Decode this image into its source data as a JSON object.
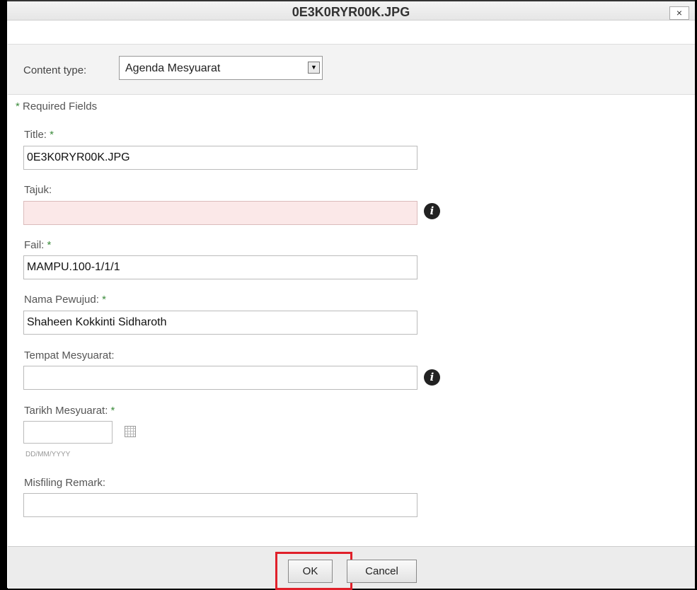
{
  "dialog": {
    "title": "0E3K0RYR00K.JPG",
    "close_label": "×"
  },
  "content_type": {
    "label": "Content type:",
    "value": "Agenda Mesyuarat"
  },
  "required_note": {
    "star": "*",
    "text": " Required Fields"
  },
  "fields": {
    "title": {
      "label": "Title:",
      "star": "*",
      "value": "0E3K0RYR00K.JPG"
    },
    "tajuk": {
      "label": "Tajuk:",
      "value": ""
    },
    "fail": {
      "label": "Fail:",
      "star": "*",
      "value": "MAMPU.100-1/1/1"
    },
    "nama_pewujud": {
      "label": "Nama Pewujud:",
      "star": "*",
      "value": "Shaheen Kokkinti Sidharoth"
    },
    "tempat_mesyuarat": {
      "label": "Tempat Mesyuarat:",
      "value": ""
    },
    "tarikh_mesyuarat": {
      "label": "Tarikh Mesyuarat:",
      "star": "*",
      "value": "",
      "format_hint": "DD/MM/YYYY"
    },
    "misfiling_remark": {
      "label": "Misfiling Remark:",
      "value": ""
    }
  },
  "icons": {
    "info": "i"
  },
  "buttons": {
    "ok": "OK",
    "cancel": "Cancel"
  },
  "colors": {
    "required_star": "#3c8c3c",
    "highlight": "#e0202a",
    "invalid_field": "#fbe8e8"
  }
}
